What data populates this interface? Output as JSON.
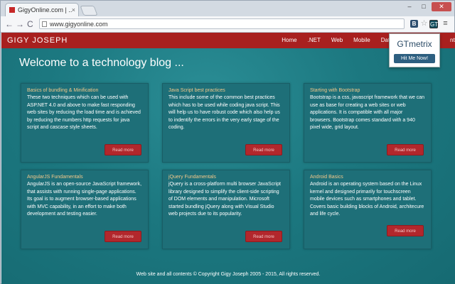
{
  "browser": {
    "tab_title": "GigyOnline.com | ...",
    "tab_close": "×",
    "url": "www.gigyonline.com",
    "ext_b": "B",
    "ext_star": "☆",
    "ext_gt": "GT",
    "menu_icon": "≡",
    "back": "←",
    "forward": "→",
    "reload": "C",
    "win_min": "–",
    "win_max": "□",
    "win_close": "✕"
  },
  "site": {
    "brand": "GIGY JOSEPH",
    "menu": [
      "Home",
      ".NET",
      "Web",
      "Mobile",
      "Database"
    ],
    "menu_last": "nt",
    "welcome": "Welcome to a technology blog ...",
    "footer": "Web site and all contents © Copyright Gigy Joseph 2005 - 2015, All rights reserved."
  },
  "cards": [
    {
      "title": "Basics of bundling & Minification",
      "text": "These two techniques which can be used with ASP.NET 4.0 and above to make fast responding web sites by reducing the load time and is achieved by reducing the numbers http requests for java script and cascase style sheets.",
      "button": "Read more"
    },
    {
      "title": "Java Script best practices",
      "text": "This include some of the common best practices which has to be used while coding java script. This will help us to have robust code which also help us to indentify the errors in the very early stage of the coding.",
      "button": "Read more"
    },
    {
      "title": "Starting with Bootstrap",
      "text": "Bootstrap is a css, javascript framework that we can use as base for creating a web sites or web applications. It is compatible with all major browsers. Bootstrap comes standard with a 940 pixel wide, grid layout.",
      "button": "Read more"
    },
    {
      "title": "AngularJS Fundamentals",
      "text": "AngularJS is an open-source JavaScript framework, that assists with running single-page applications. Its goal is to augment browser-based applications with MVC capability, in an effort to make both development and testing easier.",
      "button": "Read more"
    },
    {
      "title": "jQuery Fundamentals",
      "text": "jQuery is a cross-platform multi browser JavaScript library designed to simplify the client-side scripting of DOM elements and manipulation. Microsoft started bundling jQuery along with Visual Studio web projects due to its popularity.",
      "button": "Read more"
    },
    {
      "title": "Android Basics",
      "text": "Android is an operating system based on the Linux kernel and designed primarily for touchscreen mobile devices such as smartphones and tablet. Covers basic building blocks of Android, architecure and life cycle.",
      "button": "Read more"
    }
  ],
  "gtmetrix": {
    "title": "GTmetrix",
    "button": "Hit Me Now!"
  }
}
